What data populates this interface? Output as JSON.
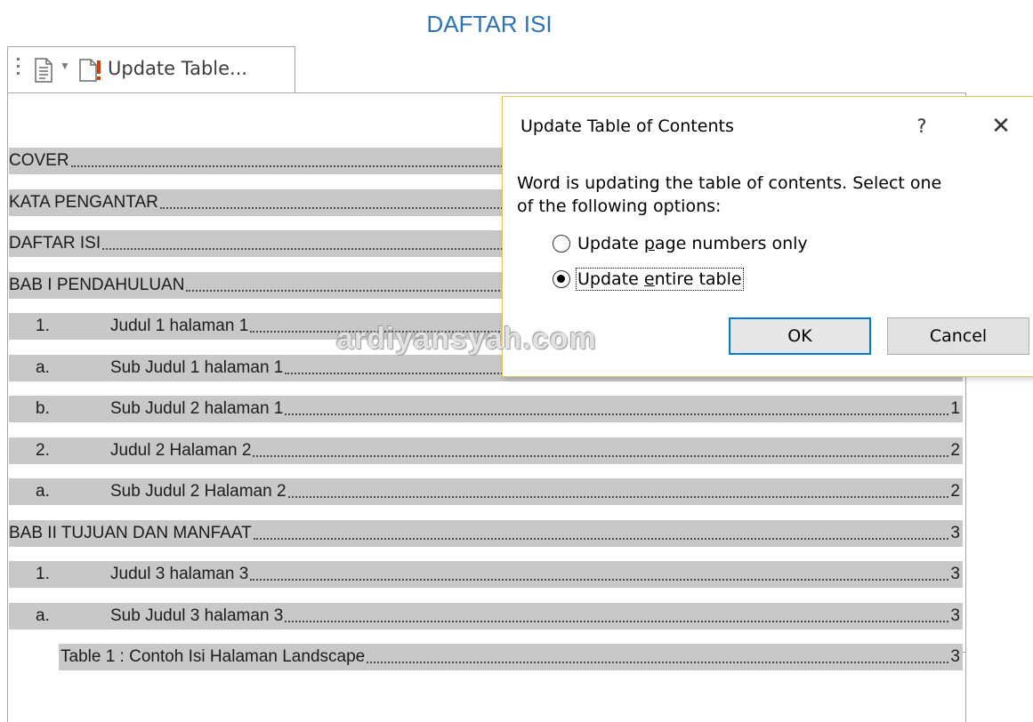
{
  "document": {
    "heading": "DAFTAR ISI"
  },
  "content_control": {
    "update_button_label": "Update Table..."
  },
  "toc": {
    "entries": [
      {
        "num": "",
        "text": "COVER",
        "page": "",
        "level": 0
      },
      {
        "num": "",
        "text": "KATA PENGANTAR",
        "page": "",
        "level": 0
      },
      {
        "num": "",
        "text": "DAFTAR ISI",
        "page": "",
        "level": 0
      },
      {
        "num": "",
        "text": "BAB I PENDAHULUAN",
        "page": "",
        "level": 0
      },
      {
        "num": "1.",
        "text": "Judul 1 halaman 1",
        "page": "",
        "level": 1
      },
      {
        "num": "a.",
        "text": "Sub Judul 1 halaman 1",
        "page": "",
        "level": 1
      },
      {
        "num": "b.",
        "text": "Sub Judul 2 halaman 1",
        "page": "1",
        "level": 1
      },
      {
        "num": "2.",
        "text": "Judul 2 Halaman 2",
        "page": "2",
        "level": 1
      },
      {
        "num": "a.",
        "text": "Sub Judul 2 Halaman 2",
        "page": "2",
        "level": 1
      },
      {
        "num": "",
        "text": "BAB II TUJUAN DAN MANFAAT",
        "page": "3",
        "level": 0
      },
      {
        "num": "1.",
        "text": "Judul 3 halaman 3",
        "page": "3",
        "level": 1
      },
      {
        "num": "a.",
        "text": "Sub Judul 3 halaman 3",
        "page": "3",
        "level": 1
      },
      {
        "num": "",
        "text": "Table 1 : Contoh Isi Halaman Landscape",
        "page": "3",
        "level": 2
      }
    ]
  },
  "dialog": {
    "title": "Update Table of Contents",
    "help": "?",
    "close": "✕",
    "message": "Word is updating the table of contents.  Select one\nof the following options:",
    "option1": {
      "pre": "Update ",
      "u": "p",
      "post": "age numbers only",
      "checked": false
    },
    "option2": {
      "pre": "Update ",
      "u": "e",
      "post": "ntire table",
      "checked": true
    },
    "ok_label": "OK",
    "cancel_label": "Cancel"
  },
  "watermark": "ardiyansyah.com",
  "colors": {
    "heading": "#2e74b5",
    "toc_highlight": "#c8c8c8",
    "annotation": "#e0201b",
    "ok_border": "#0078d7",
    "dialog_border": "#e5c365"
  },
  "icons": [
    "grip-icon",
    "document-icon",
    "dropdown-arrow-icon",
    "update-table-icon",
    "help-icon",
    "close-icon"
  ]
}
